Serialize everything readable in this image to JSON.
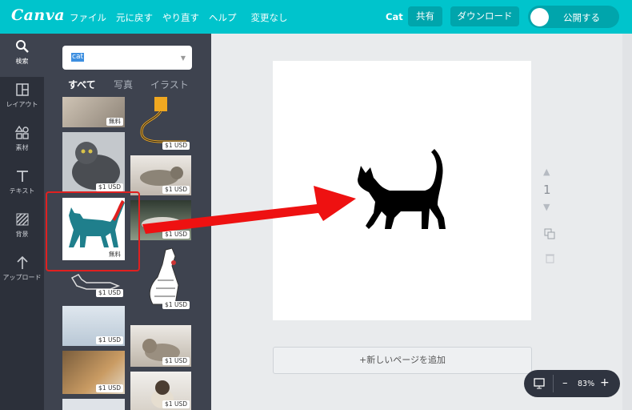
{
  "app": {
    "logo": "Canva"
  },
  "menu": {
    "file": "ファイル",
    "undo": "元に戻す",
    "redo": "やり直す",
    "help": "ヘルプ",
    "status": "変更なし"
  },
  "header": {
    "design_name": "Cat",
    "share": "共有",
    "download": "ダウンロード",
    "publish": "公開する"
  },
  "sidebar": {
    "items": [
      {
        "label": "検索",
        "icon": "search-icon"
      },
      {
        "label": "レイアウト",
        "icon": "layout-icon"
      },
      {
        "label": "素材",
        "icon": "elements-icon"
      },
      {
        "label": "テキスト",
        "icon": "text-icon"
      },
      {
        "label": "背景",
        "icon": "background-icon"
      },
      {
        "label": "アップロード",
        "icon": "upload-icon"
      }
    ]
  },
  "search": {
    "query": "cat"
  },
  "filter_tabs": {
    "all": "すべて",
    "photos": "写真",
    "illustrations": "イラスト"
  },
  "results": {
    "free": "無料",
    "paid": "$1 USD"
  },
  "canvas": {
    "add_page": "+新しいページを追加",
    "page_number": "1"
  },
  "zoom": {
    "level": "83%",
    "minus": "–",
    "plus": "+"
  },
  "colors": {
    "topbar": "#00c4cc",
    "sidebar": "#2c303a",
    "panel": "#3e434f",
    "highlight": "#e02020",
    "teal_cat": "#1f7f8c"
  }
}
